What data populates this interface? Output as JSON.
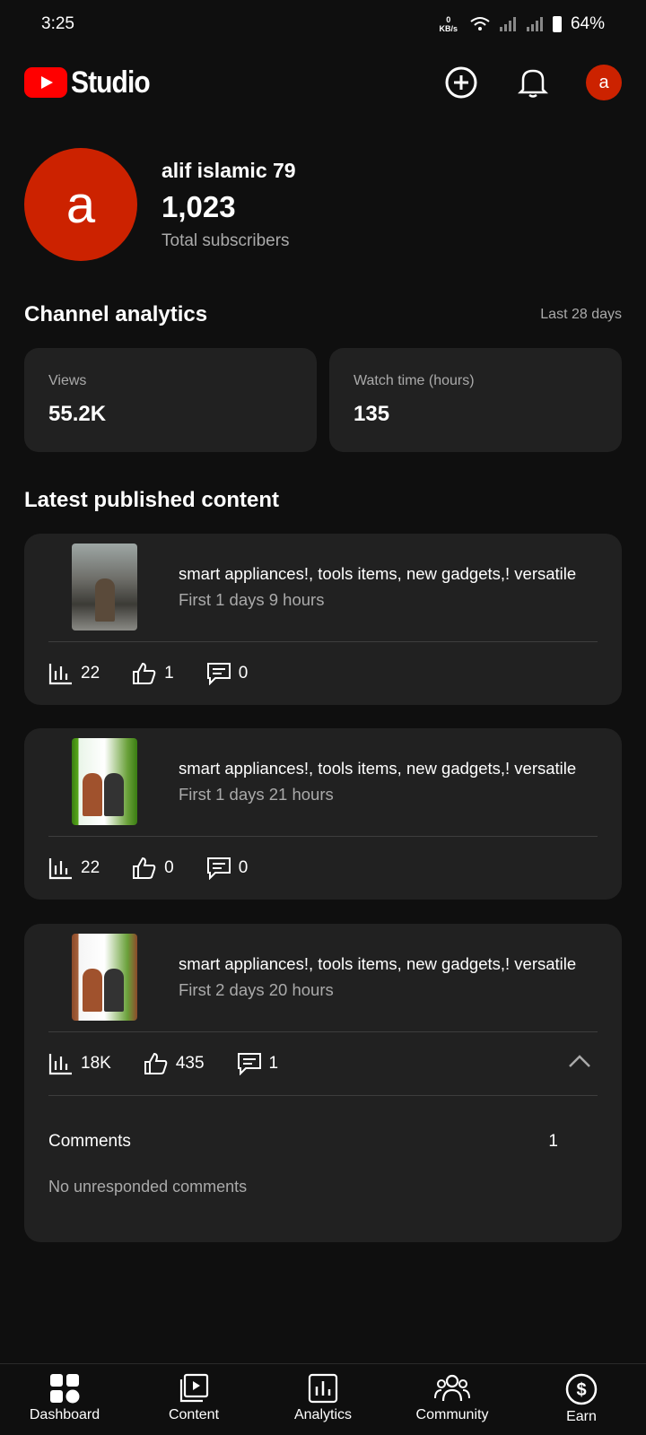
{
  "status_bar": {
    "time": "3:25",
    "net_speed": "0",
    "net_unit": "KB/s",
    "battery": "64%"
  },
  "app": {
    "logo_text": "Studio"
  },
  "header": {
    "avatar_letter": "a"
  },
  "channel": {
    "avatar_letter": "a",
    "name": "alif islamic 79",
    "subscribers": "1,023",
    "subscribers_label": "Total subscribers"
  },
  "analytics": {
    "title": "Channel analytics",
    "period": "Last 28 days",
    "cards": [
      {
        "label": "Views",
        "value": "55.2K"
      },
      {
        "label": "Watch time (hours)",
        "value": "135"
      }
    ]
  },
  "latest": {
    "title": "Latest published content",
    "videos": [
      {
        "title": "smart appliances!, tools items, new gadgets,! versatile",
        "age": "First 1 days 9 hours",
        "views": "22",
        "likes": "1",
        "comments": "0"
      },
      {
        "title": "smart appliances!, tools items, new gadgets,! versatile",
        "age": "First 1 days 21 hours",
        "views": "22",
        "likes": "0",
        "comments": "0"
      },
      {
        "title": "smart appliances!, tools items, new gadgets,! versatile",
        "age": "First 2 days 20 hours",
        "views": "18K",
        "likes": "435",
        "comments": "1"
      }
    ],
    "comments_label": "Comments",
    "comments_count": "1",
    "no_unresponded": "No unresponded comments"
  },
  "nav": {
    "items": [
      {
        "label": "Dashboard",
        "icon": "dashboard-icon"
      },
      {
        "label": "Content",
        "icon": "content-icon"
      },
      {
        "label": "Analytics",
        "icon": "analytics-icon"
      },
      {
        "label": "Community",
        "icon": "community-icon"
      },
      {
        "label": "Earn",
        "icon": "earn-icon"
      }
    ]
  },
  "colors": {
    "background": "#0f0f0f",
    "card": "#212121",
    "brand_red": "#ff0000",
    "avatar": "#cc2200",
    "secondary_text": "#aaaaaa"
  }
}
